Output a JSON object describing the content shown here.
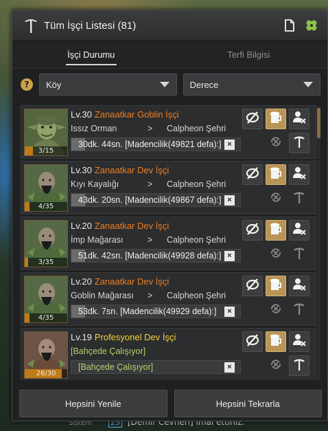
{
  "window": {
    "title": "Tüm İşçi Listesi (81)",
    "title_icon": "pickaxe-icon",
    "buttons": [
      "document-icon",
      "clover-icon"
    ]
  },
  "tabs": [
    {
      "label": "İşçi Durumu",
      "active": true
    },
    {
      "label": "Terfi Bilgisi",
      "active": false
    }
  ],
  "filters": {
    "help_label": "?",
    "location": "Köy",
    "grade": "Derece"
  },
  "workers": [
    {
      "level": "Lv.30",
      "name": "Zanaatkar Goblin İşçi",
      "grade": "artisan",
      "from": "Issız Orman",
      "arrow": ">",
      "to": "Calpheon Şehri",
      "stamina": "3/15",
      "stamina_fraction": 0.2,
      "status": "30dk. 44sn. [Madencilik(49821 defa):]",
      "progress_fraction": 0.08,
      "cancel_label": "×",
      "skin": "goblin"
    },
    {
      "level": "Lv.30",
      "name": "Zanaatkar Dev İşçi",
      "grade": "artisan",
      "from": "Kıyı Kayalığı",
      "arrow": ">",
      "to": "Calpheon Şehri",
      "stamina": "4/35",
      "stamina_fraction": 0.114,
      "status": "43dk. 20sn. [Madencilik(49867 defa):]",
      "progress_fraction": 0.08,
      "cancel_label": "×",
      "skin": "giant"
    },
    {
      "level": "Lv.20",
      "name": "Zanaatkar Dev İşçi",
      "grade": "artisan",
      "from": "İmp Mağarası",
      "arrow": ">",
      "to": "Calpheon Şehri",
      "stamina": "3/35",
      "stamina_fraction": 0.086,
      "status": "51dk. 42sn. [Madencilik(49928 defa):]",
      "progress_fraction": 0.08,
      "cancel_label": "×",
      "skin": "giant"
    },
    {
      "level": "Lv.20",
      "name": "Zanaatkar Dev İşçi",
      "grade": "artisan",
      "from": "Goblin Mağarası",
      "arrow": ">",
      "to": "Calpheon Şehri",
      "stamina": "4/35",
      "stamina_fraction": 0.114,
      "status": "53dk. 7sn. [Madencilik(49929 defa):]",
      "progress_fraction": 0.08,
      "cancel_label": "×",
      "skin": "giant"
    },
    {
      "level": "Lv.19",
      "name": "Profesyonel Dev İşçi",
      "grade": "professional",
      "from": "[Bahçede Çalışıyor]",
      "arrow": "",
      "to": "",
      "stamina": "26/30",
      "stamina_fraction": 0.867,
      "status": "[Bahçede Çalışıyor]",
      "progress_fraction": 0.0,
      "cancel_label": "×",
      "skin": "giant-pro",
      "working": true
    }
  ],
  "row_buttons": {
    "left": [
      "hide-icon",
      "hide-icon"
    ],
    "middle": [
      "beer-icon",
      "repeat-icon"
    ],
    "right": [
      "fire-worker-icon",
      "promote-pickaxe-icon"
    ]
  },
  "footer": {
    "refresh_all": "Hepsini Yenile",
    "repeat_all": "Hepsini Tekrarla"
  },
  "chat": {
    "channel": "Sistem",
    "count": "25",
    "message": "[Demir Cevheri] imal ettiniz."
  },
  "colors": {
    "artisan_name": "#f07e1e",
    "professional_name": "#f5d23a",
    "working_text": "#b3d46a",
    "stamina_fill": "#c07a1a",
    "gold_button": "#b89456"
  }
}
